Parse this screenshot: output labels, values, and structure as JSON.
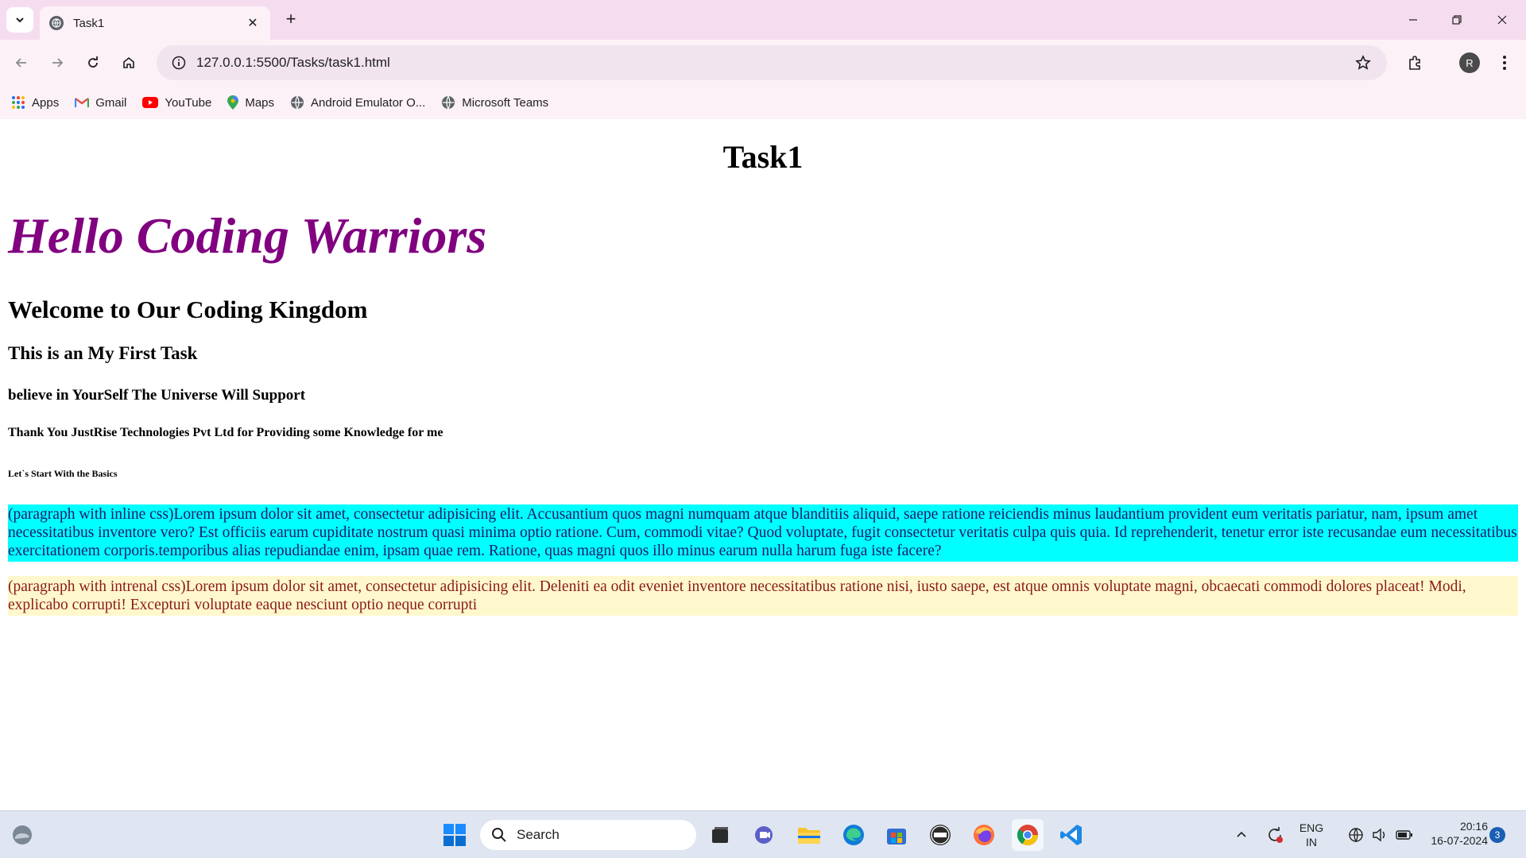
{
  "browser": {
    "tab_title": "Task1",
    "url": "127.0.0.1:5500/Tasks/task1.html",
    "profile_initial": "R",
    "bookmarks": [
      {
        "label": "Apps",
        "icon": "apps-grid-icon"
      },
      {
        "label": "Gmail",
        "icon": "gmail-icon"
      },
      {
        "label": "YouTube",
        "icon": "youtube-icon"
      },
      {
        "label": "Maps",
        "icon": "maps-pin-icon"
      },
      {
        "label": "Android Emulator O...",
        "icon": "globe-icon"
      },
      {
        "label": "Microsoft Teams",
        "icon": "globe-icon"
      }
    ]
  },
  "page": {
    "title": "Task1",
    "hello": "Hello Coding Warriors",
    "h2": "Welcome to Our Coding Kingdom",
    "h3": "This is an My First Task",
    "h4": "believe in YourSelf The Universe Will Support",
    "h5": "Thank You JustRise Technologies Pvt Ltd for Providing some Knowledge for me",
    "h6": "Let`s Start With the Basics",
    "para_inline": "(paragraph with inline css)Lorem ipsum dolor sit amet, consectetur adipisicing elit. Accusantium quos magni numquam atque blanditiis aliquid, saepe ratione reiciendis minus laudantium provident eum veritatis pariatur, nam, ipsum amet necessitatibus inventore vero? Est officiis earum cupiditate nostrum quasi minima optio ratione. Cum, commodi vitae? Quod voluptate, fugit consectetur veritatis culpa quis quia. Id reprehenderit, tenetur error iste recusandae eum necessitatibus exercitationem corporis.temporibus alias repudiandae enim, ipsam quae rem. Ratione, quas magni quos illo minus earum nulla harum fuga iste facere?",
    "para_internal": "(paragraph with intrenal css)Lorem ipsum dolor sit amet, consectetur adipisicing elit. Deleniti ea odit eveniet inventore necessitatibus ratione nisi, iusto saepe, est atque omnis voluptate magni, obcaecati commodi dolores placeat! Modi, explicabo corrupti! Excepturi voluptate eaque nesciunt optio neque corrupti"
  },
  "taskbar": {
    "search_placeholder": "Search",
    "lang_top": "ENG",
    "lang_bottom": "IN",
    "time": "20:16",
    "date": "16-07-2024",
    "notification_count": "3"
  },
  "colors": {
    "tabbar": "#f6dcef",
    "hello_text": "#800080",
    "para_inline_bg": "#00ffff",
    "para_internal_bg": "#fff8cc"
  }
}
